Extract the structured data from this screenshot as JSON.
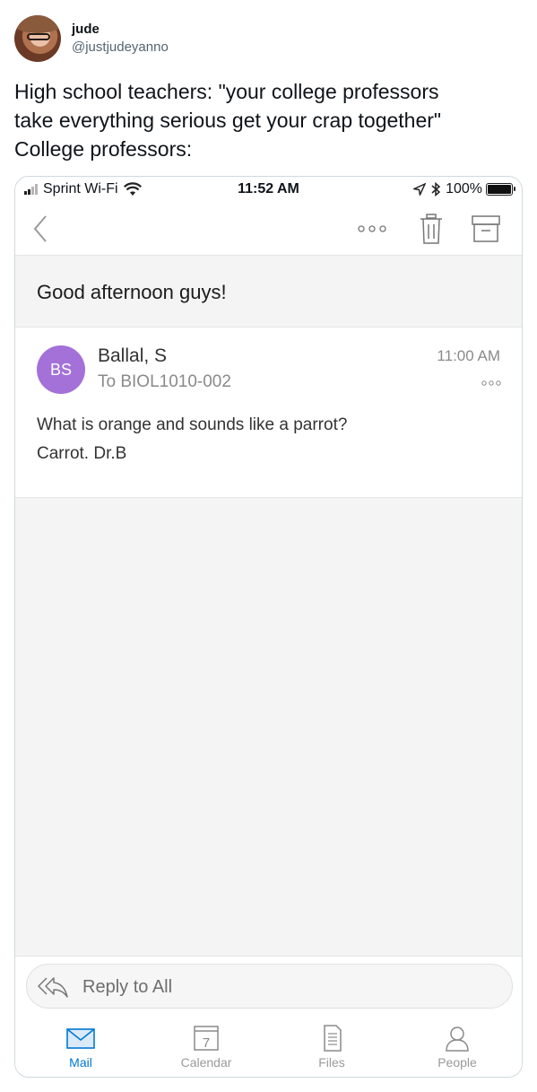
{
  "tweet": {
    "display_name": "jude",
    "handle": "@justjudeyanno",
    "text_lines": [
      "High school teachers: \"your college professors",
      "take everything serious get your crap together\"",
      "College professors:"
    ]
  },
  "status_bar": {
    "carrier": "Sprint Wi-Fi",
    "time": "11:52 AM",
    "battery": "100%"
  },
  "email": {
    "subject": "Good afternoon guys!",
    "sender_initials": "BS",
    "sender_name": "Ballal, S",
    "recipient": "To BIOL1010-002",
    "time": "11:00 AM",
    "body_lines": [
      "What is orange and sounds like a parrot?",
      "Carrot. Dr.B"
    ],
    "avatar_color": "#a371d8"
  },
  "reply": {
    "label": "Reply to All"
  },
  "tabs": [
    {
      "label": "Mail",
      "icon": "mail-icon",
      "active": true
    },
    {
      "label": "Calendar",
      "icon": "calendar-icon",
      "day": "7"
    },
    {
      "label": "Files",
      "icon": "files-icon"
    },
    {
      "label": "People",
      "icon": "people-icon"
    }
  ],
  "colors": {
    "accent": "#0078d4",
    "tab_inactive": "#9a9a9a"
  }
}
